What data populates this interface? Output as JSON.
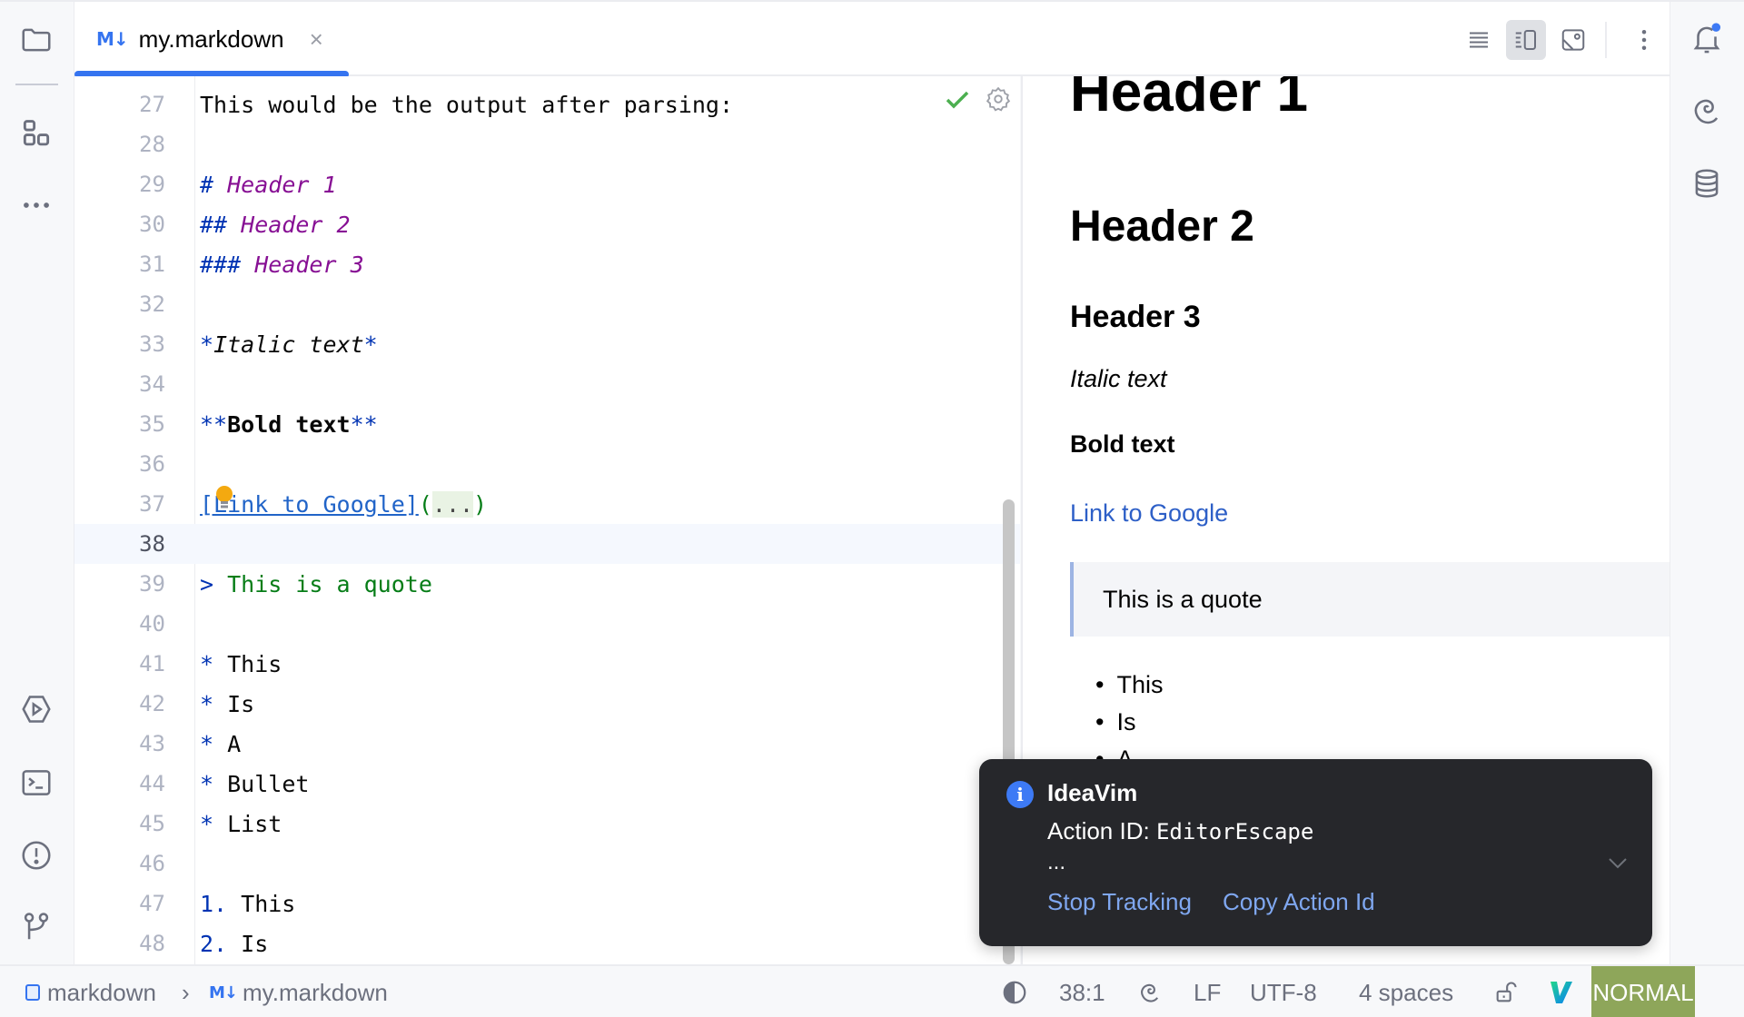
{
  "left_toolbar": {
    "top_icons": [
      "folder-icon",
      "structure-icon",
      "more-icon"
    ],
    "bottom_icons": [
      "run-icon",
      "terminal-icon",
      "problems-icon",
      "git-icon"
    ]
  },
  "right_toolbar": {
    "icons": [
      "notifications-icon",
      "ai-assistant-icon",
      "database-icon"
    ],
    "notification_badge_color": "#3d7af5"
  },
  "tabs": [
    {
      "icon": "M↓",
      "label": "my.markdown",
      "close": "×",
      "active": true
    }
  ],
  "editor_toolbar": {
    "buttons": [
      "editor-only",
      "editor-and-preview",
      "preview-only",
      "more-options"
    ],
    "active": "editor-and-preview"
  },
  "editor": {
    "status": {
      "check": "✓",
      "settings": "gear"
    },
    "current_line": 38,
    "lines": [
      {
        "n": "27",
        "text": "This would be the output after parsing:"
      },
      {
        "n": "28",
        "text": ""
      },
      {
        "n": "29",
        "mark": "# ",
        "head": "Header 1"
      },
      {
        "n": "30",
        "mark": "## ",
        "head": "Header 2"
      },
      {
        "n": "31",
        "mark": "### ",
        "head": "Header 3"
      },
      {
        "n": "32",
        "text": ""
      },
      {
        "n": "33",
        "mark": "*",
        "italic": "Italic text",
        "mark2": "*"
      },
      {
        "n": "34",
        "text": ""
      },
      {
        "n": "35",
        "mark": "**",
        "bold": "Bold text",
        "mark2": "**"
      },
      {
        "n": "36",
        "text": ""
      },
      {
        "n": "37",
        "link": "[Link to Google]",
        "paren_open": "(",
        "fold": "...",
        "paren_close": ")"
      },
      {
        "n": "38",
        "text": ""
      },
      {
        "n": "39",
        "mark": "> ",
        "quote": "This is a quote"
      },
      {
        "n": "40",
        "text": ""
      },
      {
        "n": "41",
        "mark": "* ",
        "text": "This"
      },
      {
        "n": "42",
        "mark": "* ",
        "text": "Is"
      },
      {
        "n": "43",
        "mark": "* ",
        "text": "A"
      },
      {
        "n": "44",
        "mark": "* ",
        "text": "Bullet"
      },
      {
        "n": "45",
        "mark": "* ",
        "text": "List"
      },
      {
        "n": "46",
        "text": ""
      },
      {
        "n": "47",
        "mark": "1. ",
        "text": "This"
      },
      {
        "n": "48",
        "mark": "2. ",
        "text": "Is"
      }
    ]
  },
  "preview": {
    "h1": "Header 1",
    "h2": "Header 2",
    "h3": "Header 3",
    "italic": "Italic text",
    "bold": "Bold text",
    "link": "Link to Google",
    "quote": "This is a quote",
    "bullets": [
      "This",
      "Is",
      "A"
    ]
  },
  "notification": {
    "title": "IdeaVim",
    "body_label": "Action ID: ",
    "body_value": "EditorEscape",
    "ellipsis": "...",
    "actions": [
      "Stop Tracking",
      "Copy Action Id"
    ]
  },
  "status_bar": {
    "breadcrumb": [
      "markdown",
      "my.markdown"
    ],
    "breadcrumb_sep": "›",
    "md_icon": "M↓",
    "position": "38:1",
    "line_separator": "LF",
    "encoding": "UTF-8",
    "indent": "4 spaces",
    "vim_mode": "NORMAL"
  }
}
